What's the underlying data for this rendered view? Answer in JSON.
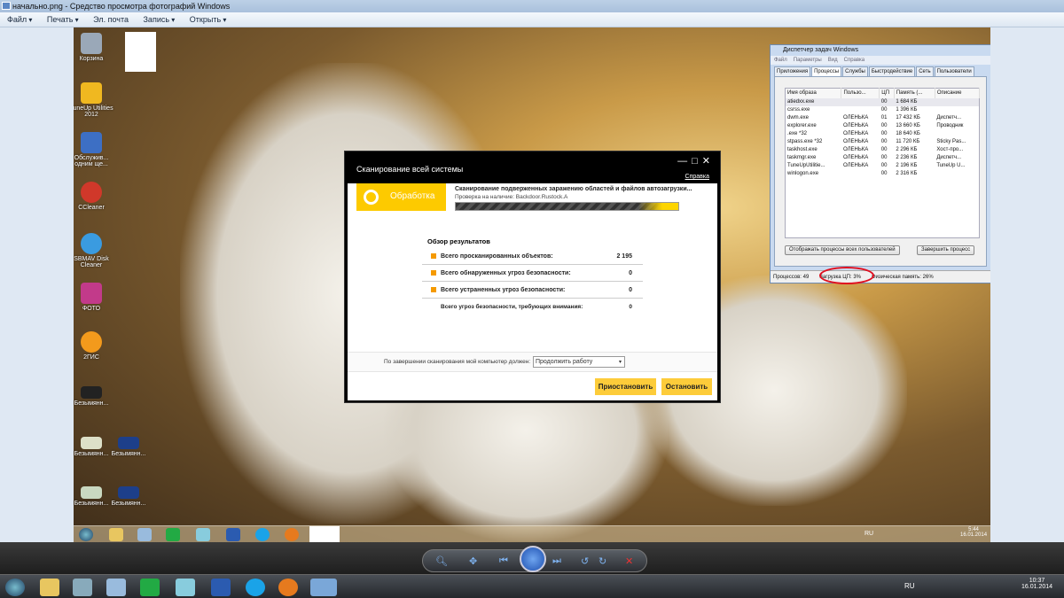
{
  "window": {
    "title": "начально.png - Средство просмотра фотографий Windows"
  },
  "menu": [
    "Файл",
    "Печать",
    "Эл. почта",
    "Запись",
    "Открыть"
  ],
  "desktop_icons": [
    "Корзина",
    "TuneUp Utilities 2012",
    "Обслужив... одним ще...",
    "CCleaner",
    "SBMAV Disk Cleaner",
    "ФОТО",
    "2ГИС",
    "Безымянн...",
    "Безымянн...",
    "Безымянн...",
    "Безымянн...",
    "Безымянн..."
  ],
  "task_manager": {
    "title": "Диспетчер задач Windows",
    "menu": [
      "Файл",
      "Параметры",
      "Вид",
      "Справка"
    ],
    "tabs": [
      "Приложения",
      "Процессы",
      "Службы",
      "Быстродействие",
      "Сеть",
      "Пользователи"
    ],
    "active_tab": "Процессы",
    "columns": [
      "Имя образа",
      "Пользо...",
      "ЦП",
      "Память (...",
      "Описание"
    ],
    "rows": [
      [
        "atiedxx.exe",
        "",
        "00",
        "1 684 КБ",
        ""
      ],
      [
        "csrss.exe",
        "",
        "00",
        "1 396 КБ",
        ""
      ],
      [
        "dwm.exe",
        "ОЛЕНЬКА",
        "01",
        "17 432 КБ",
        "Диспетч..."
      ],
      [
        "explorer.exe",
        "ОЛЕНЬКА",
        "00",
        "13 660 КБ",
        "Проводник"
      ],
      [
        "  .exe *32",
        "ОЛЕНЬКА",
        "00",
        "18 640 КБ",
        ""
      ],
      [
        "stpass.exe *32",
        "ОЛЕНЬКА",
        "00",
        "11 720 КБ",
        "Sticky Pas..."
      ],
      [
        "taskhost.exe",
        "ОЛЕНЬКА",
        "00",
        "2 296 КБ",
        "Хост-про..."
      ],
      [
        "taskmgr.exe",
        "ОЛЕНЬКА",
        "00",
        "2 236 КБ",
        "Диспетч..."
      ],
      [
        "TuneUpUtilitie...",
        "ОЛЕНЬКА",
        "00",
        "2 196 КБ",
        "TuneUp U..."
      ],
      [
        "winlogon.exe",
        "",
        "00",
        "2 316 КБ",
        ""
      ]
    ],
    "show_all_button": "Отображать процессы всех пользователей",
    "end_process_button": "Завершить процесс",
    "status": {
      "processes": "Процессов: 49",
      "cpu": "Загрузка ЦП: 3%",
      "memory": "Физическая память: 26%"
    }
  },
  "scan": {
    "title": "Сканирование всей системы",
    "help": "Справка",
    "state": "Обработка",
    "status_line": "Сканирование подверженных заражению областей и файлов автозагрузки...",
    "check_line": "Проверка на наличие: Backdoor.Rustock.A",
    "summary_title": "Обзор результатов",
    "results": [
      {
        "label": "Всего просканированных объектов:",
        "value": "2 195"
      },
      {
        "label": "Всего обнаруженных угроз безопасности:",
        "value": "0"
      },
      {
        "label": "Всего устраненных угроз безопасности:",
        "value": "0"
      },
      {
        "label": "Всего угроз безопасности, требующих внимания:",
        "value": "0"
      }
    ],
    "after_label": "По завершении сканирования мой компьютер должен:",
    "after_value": "Продолжить работу",
    "pause_button": "Приостановить",
    "stop_button": "Остановить"
  },
  "inner_tray": {
    "lang": "RU",
    "time": "5:44",
    "date": "16.01.2014"
  },
  "outer_tray": {
    "lang": "RU",
    "time": "10:37",
    "date": "16.01.2014"
  }
}
